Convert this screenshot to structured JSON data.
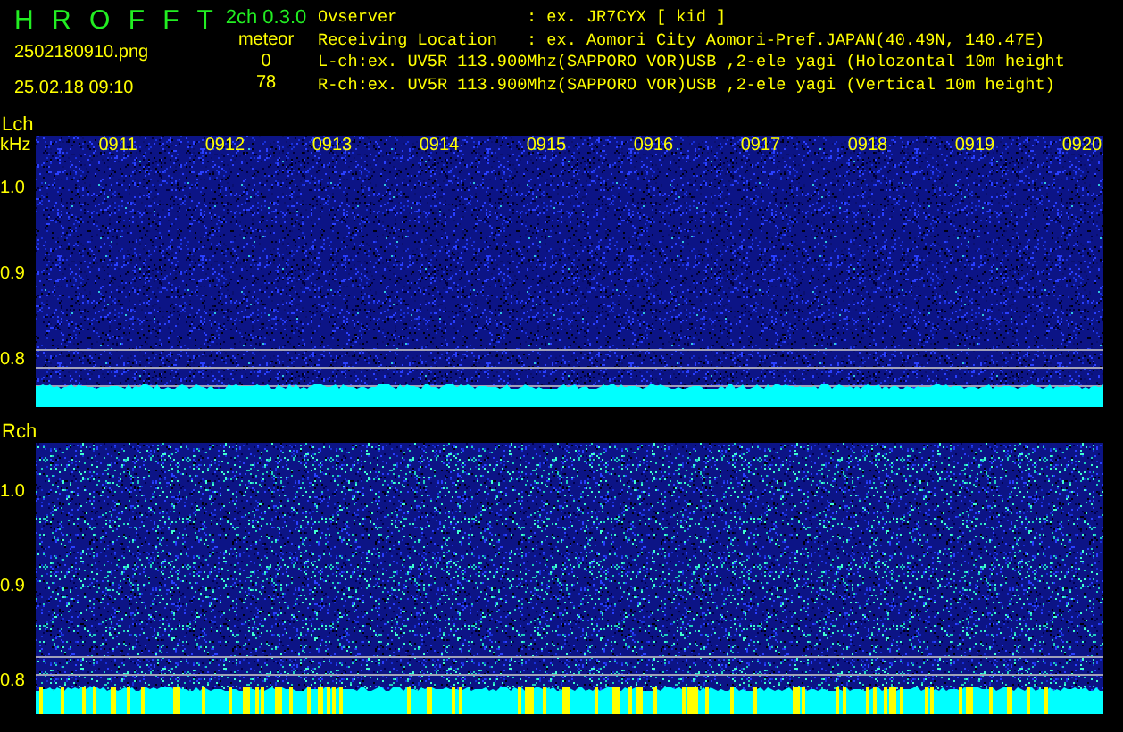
{
  "header": {
    "app_name": "H R O F F T",
    "version": "2ch 0.3.0",
    "filename": "2502180910.png",
    "datetime": "25.02.18 09:10",
    "meteor_label": "meteor",
    "counts": [
      "0",
      "78"
    ],
    "info": [
      {
        "label": "Ovserver",
        "value": ": ex. JR7CYX [ kid ]"
      },
      {
        "label": "Receiving Location",
        "value": ": ex. Aomori City Aomori-Pref.JAPAN(40.49N, 140.47E)"
      },
      {
        "value": "L-ch:ex. UV5R 113.900Mhz(SAPPORO VOR)USB ,2-ele yagi (Holozontal 10m height"
      },
      {
        "value": "R-ch:ex. UV5R 113.900Mhz(SAPPORO VOR)USB ,2-ele yagi (Vertical 10m height)"
      }
    ]
  },
  "panels": [
    {
      "channel": "Lch",
      "unit": "kHz",
      "time_labels": [
        "0911",
        "0912",
        "0913",
        "0914",
        "0915",
        "0916",
        "0917",
        "0918",
        "0919",
        "0920"
      ],
      "y_labels": [
        "1.0",
        "0.9",
        "0.8"
      ]
    },
    {
      "channel": "Rch",
      "y_labels": [
        "1.0",
        "0.9",
        "0.8"
      ]
    }
  ]
}
